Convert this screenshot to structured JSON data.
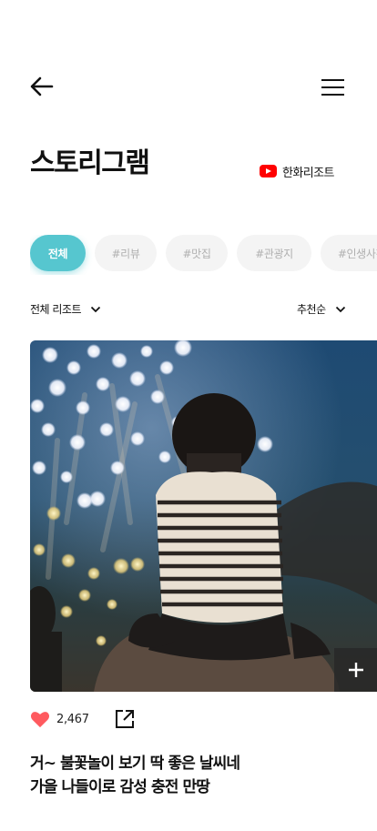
{
  "header": {
    "title": "스토리그램",
    "channel_label": "한화리조트",
    "channel_icon": "youtube-icon",
    "back_icon": "arrow-left-icon",
    "menu_icon": "hamburger-menu-icon"
  },
  "tags": [
    "전체",
    "#리뷰",
    "#맛집",
    "#관광지",
    "#인생사진"
  ],
  "filters": {
    "resort_label": "전체 리조트",
    "sort_label": "추천순"
  },
  "post": {
    "like_count": "2,467",
    "caption_line1": "거~ 불꽃놀이 보기 딱 좋은 날씨네",
    "caption_line2": "가을 나들이로 감성 충전 만땅",
    "image_alt": "child on shoulders watching fireworks"
  },
  "colors": {
    "accent": "#56c6cf",
    "like": "#ff5a5f",
    "youtube": "#ff0000"
  }
}
